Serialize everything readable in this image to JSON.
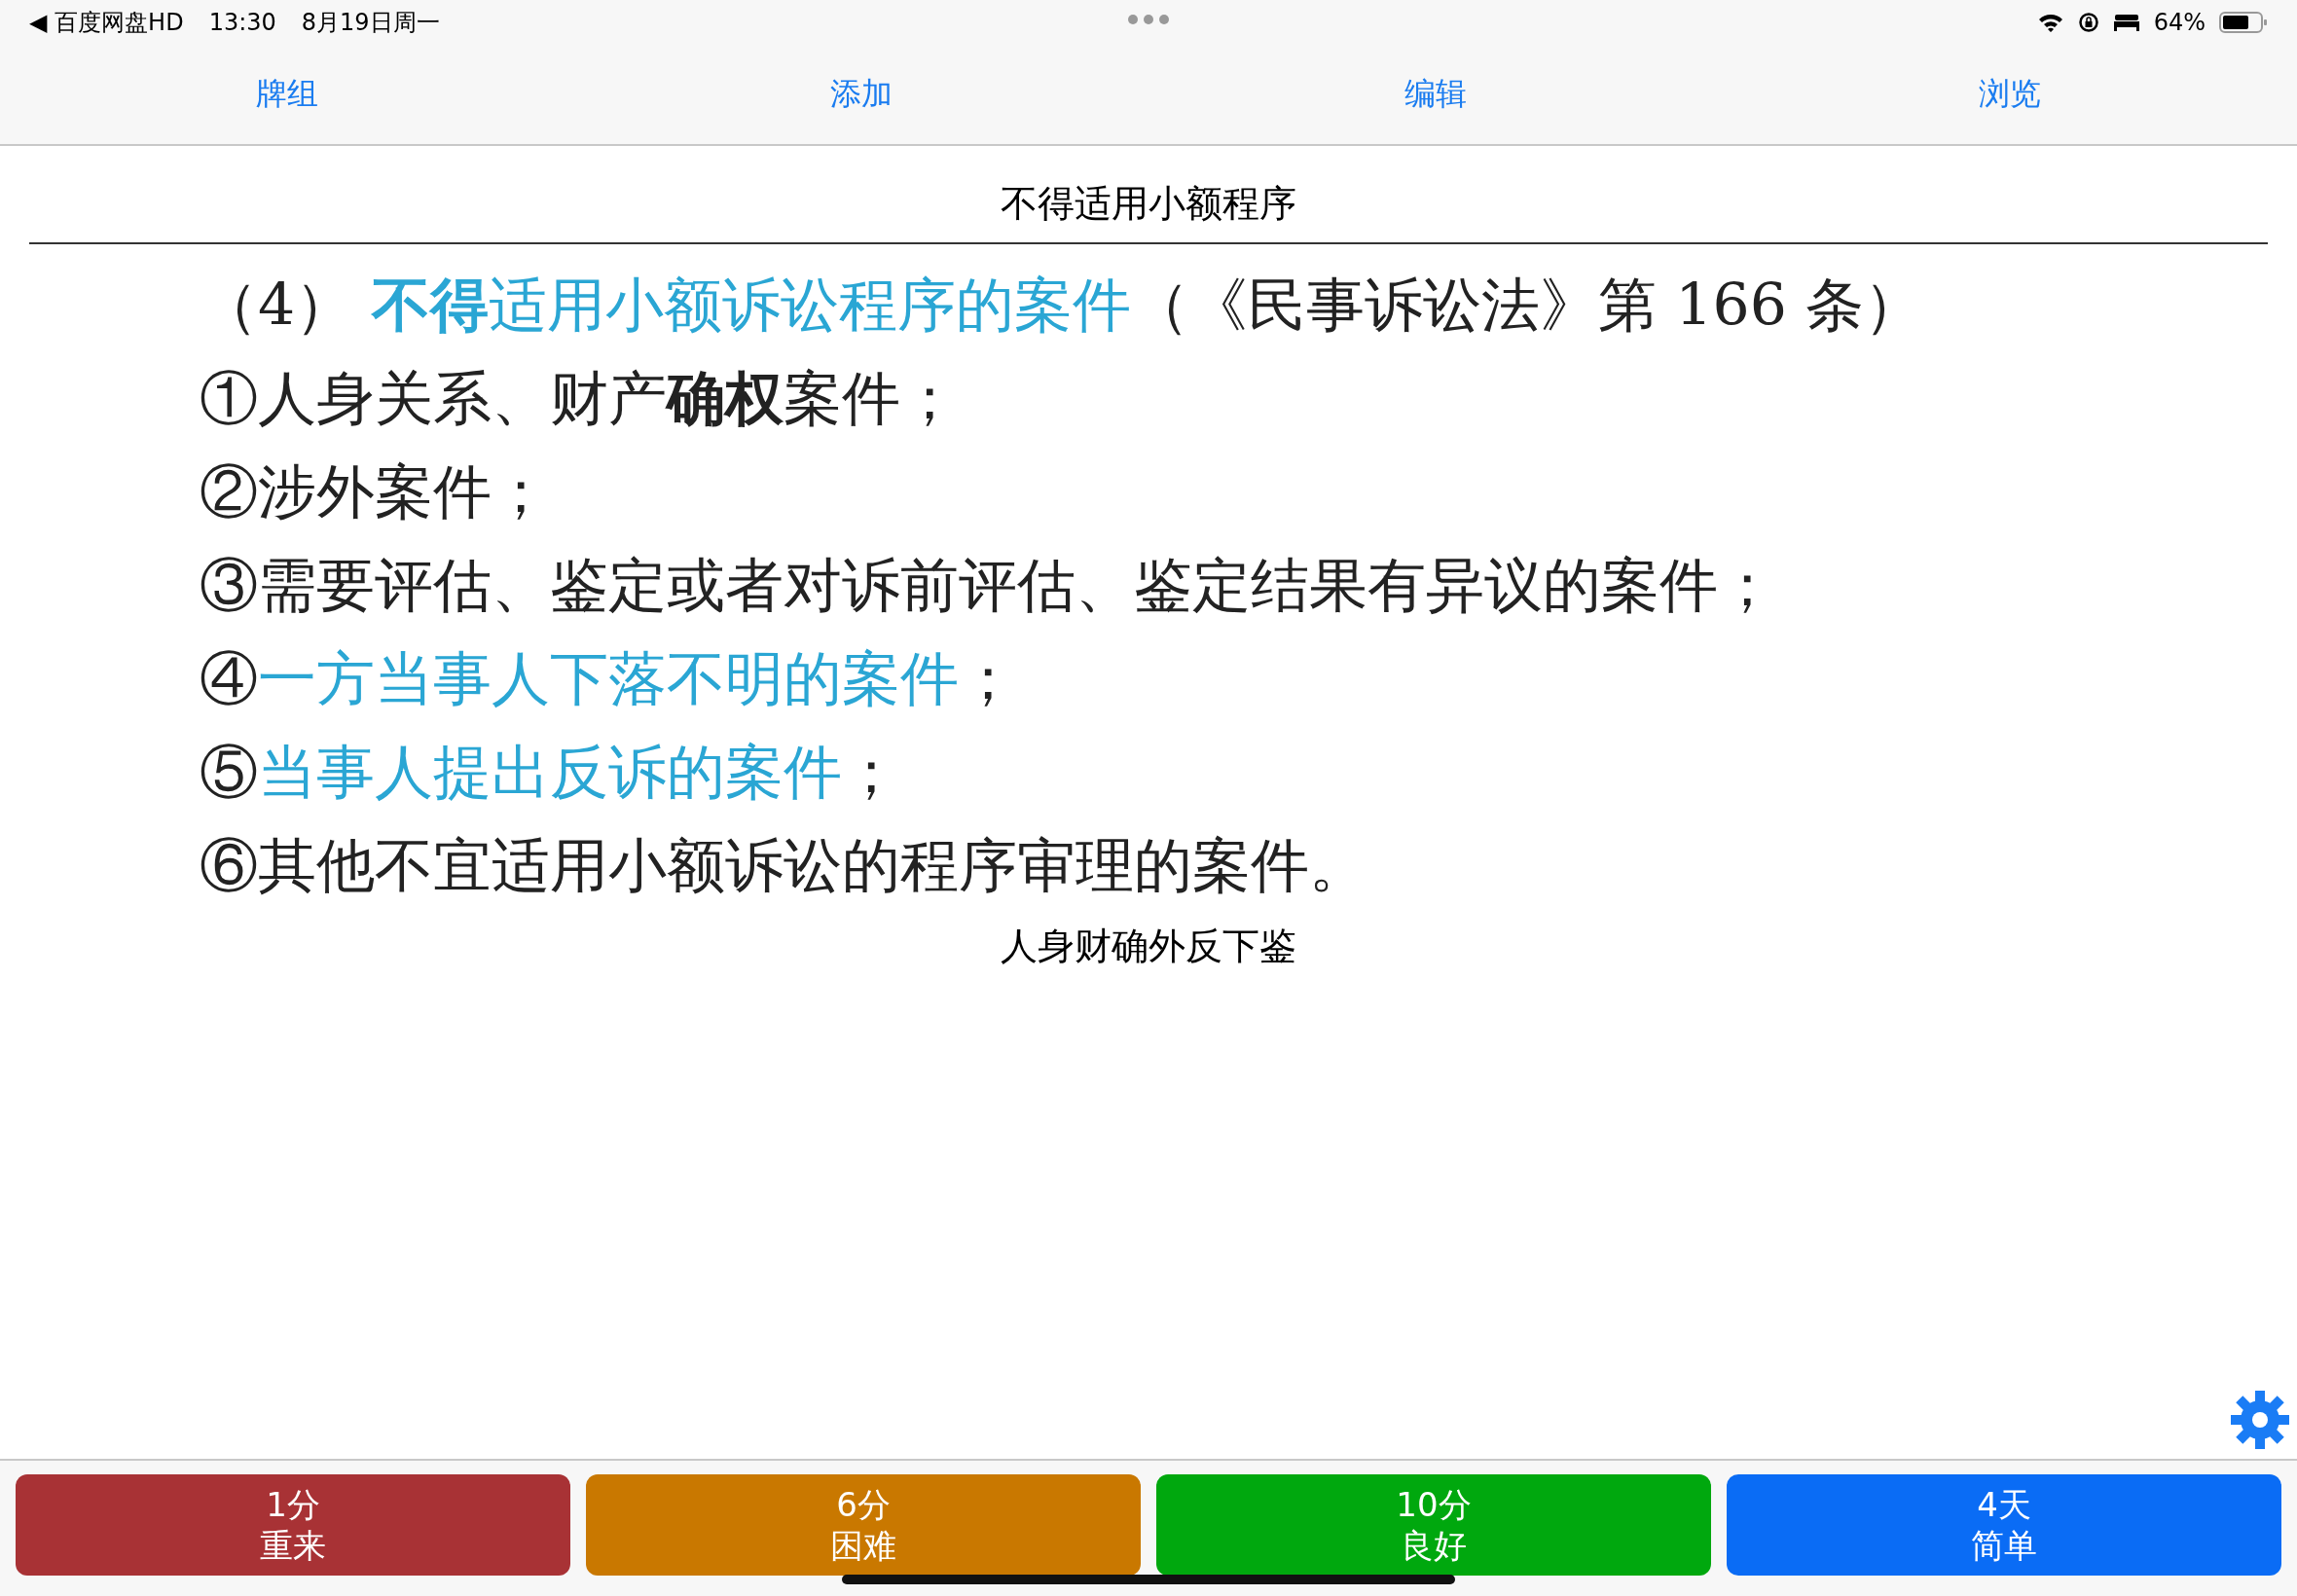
{
  "status_bar": {
    "back_app": "◀ 百度网盘HD",
    "time": "13:30",
    "date": "8月19日周一",
    "battery": "64%"
  },
  "tabs": [
    {
      "label": "牌组"
    },
    {
      "label": "添加"
    },
    {
      "label": "编辑"
    },
    {
      "label": "浏览"
    }
  ],
  "card": {
    "front": "不得适用小额程序",
    "document_lines": [
      [
        {
          "text": "（4） ",
          "kind": "plain"
        },
        {
          "text": "**不得**适用小额诉讼程序的案件",
          "kind": "highlighted"
        },
        {
          "text": "（《民事诉讼法》第 166 条）",
          "kind": "plain"
        }
      ],
      [
        {
          "text": "①人身关系、财产**确权**案件；",
          "kind": "plain"
        }
      ],
      [
        {
          "text": "②涉外案件；",
          "kind": "plain"
        }
      ],
      [
        {
          "text": "③需要评估、鉴定或者对诉前评估、鉴定结果有异议的案件；",
          "kind": "plain"
        }
      ],
      [
        {
          "text": "④",
          "kind": "plain"
        },
        {
          "text": "一方当事人下落不明的案件",
          "kind": "highlighted"
        },
        {
          "text": "；",
          "kind": "plain"
        }
      ],
      [
        {
          "text": "⑤",
          "kind": "plain"
        },
        {
          "text": "当事人提出反诉的案件",
          "kind": "highlighted"
        },
        {
          "text": "；",
          "kind": "plain"
        }
      ],
      [
        {
          "text": "⑥其他不宜适用小额诉讼的程序审理的案件。",
          "kind": "plain"
        }
      ]
    ],
    "back_note": "人身财确外反下鉴"
  },
  "answer_buttons": [
    {
      "interval": "1分",
      "label": "重来",
      "color": "#a83235"
    },
    {
      "interval": "6分",
      "label": "困难",
      "color": "#c97800"
    },
    {
      "interval": "10分",
      "label": "良好",
      "color": "#00a80e"
    },
    {
      "interval": "4天",
      "label": "简单",
      "color": "#0a6cf5"
    }
  ]
}
